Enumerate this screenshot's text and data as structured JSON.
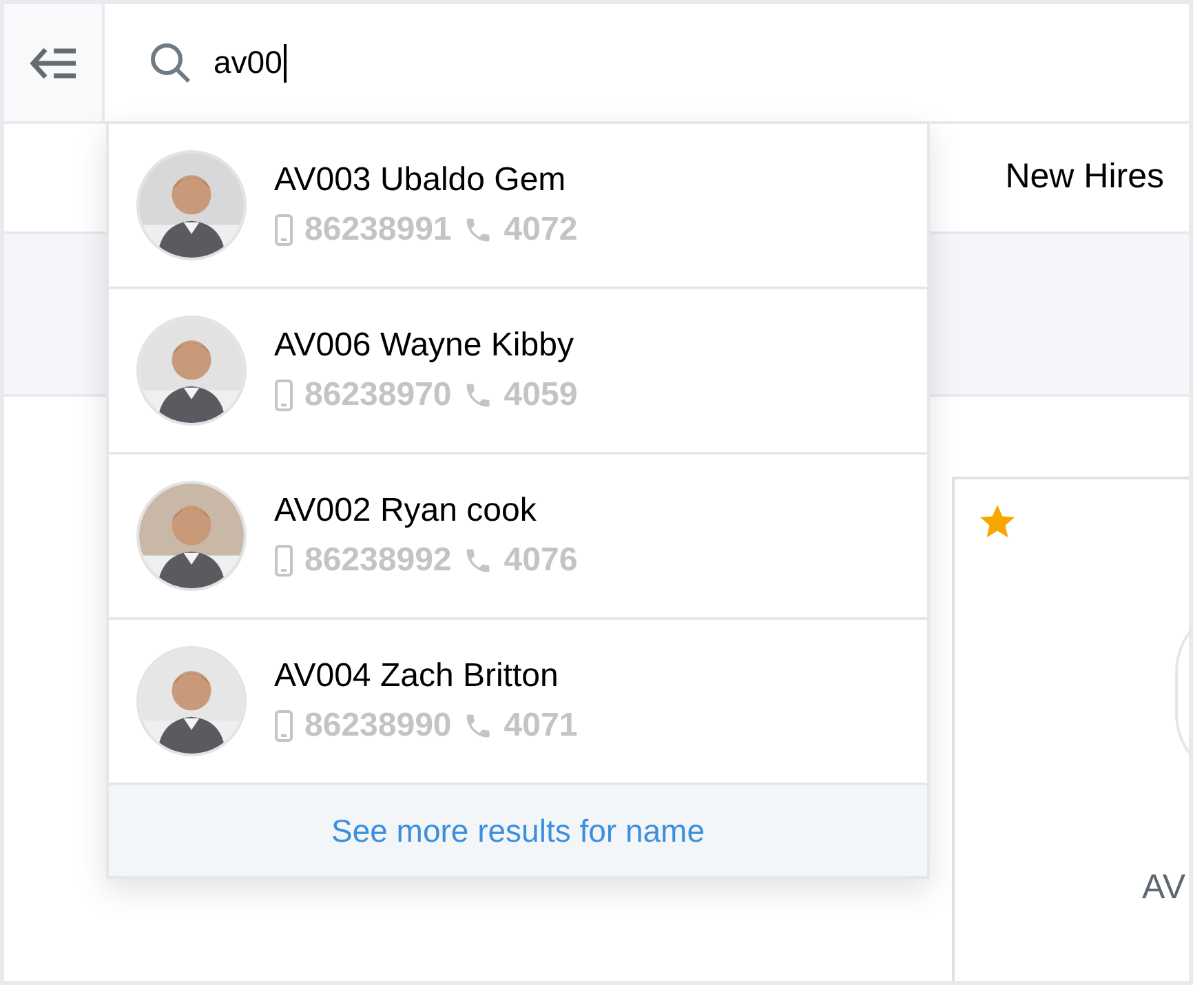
{
  "search": {
    "value": "av00"
  },
  "tabs": [
    {
      "label": "New Hires",
      "selected": false
    }
  ],
  "results": [
    {
      "title": "AV003 Ubaldo Gem",
      "mobile": "86238991",
      "phone": "4072"
    },
    {
      "title": "AV006 Wayne Kibby",
      "mobile": "86238970",
      "phone": "4059"
    },
    {
      "title": "AV002 Ryan cook",
      "mobile": "86238992",
      "phone": "4076"
    },
    {
      "title": "AV004 Zach Britton",
      "mobile": "86238990",
      "phone": "4071"
    }
  ],
  "more_link": "See more results for name",
  "card": {
    "favorite": true,
    "title": "AV"
  }
}
